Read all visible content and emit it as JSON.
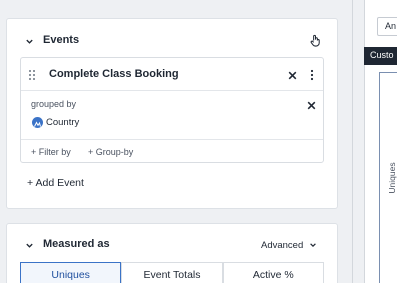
{
  "events": {
    "title": "Events",
    "event_name": "Complete Class Booking",
    "grouped_by_label": "grouped by",
    "group_property": "Country",
    "filter_by_label": "+ Filter by",
    "group_by_label": "+ Group-by",
    "add_event_label": "+ Add Event"
  },
  "measured_as": {
    "title": "Measured as",
    "advanced_label": "Advanced",
    "options": [
      "Uniques",
      "Event Totals",
      "Active %"
    ],
    "selected": "Uniques"
  },
  "right_panel": {
    "button_label": "An",
    "tooltip_text": "Custo",
    "y_axis_label": "Uniques"
  },
  "colors": {
    "accent": "#3b73c7",
    "tooltip_bg": "#1f2733"
  }
}
